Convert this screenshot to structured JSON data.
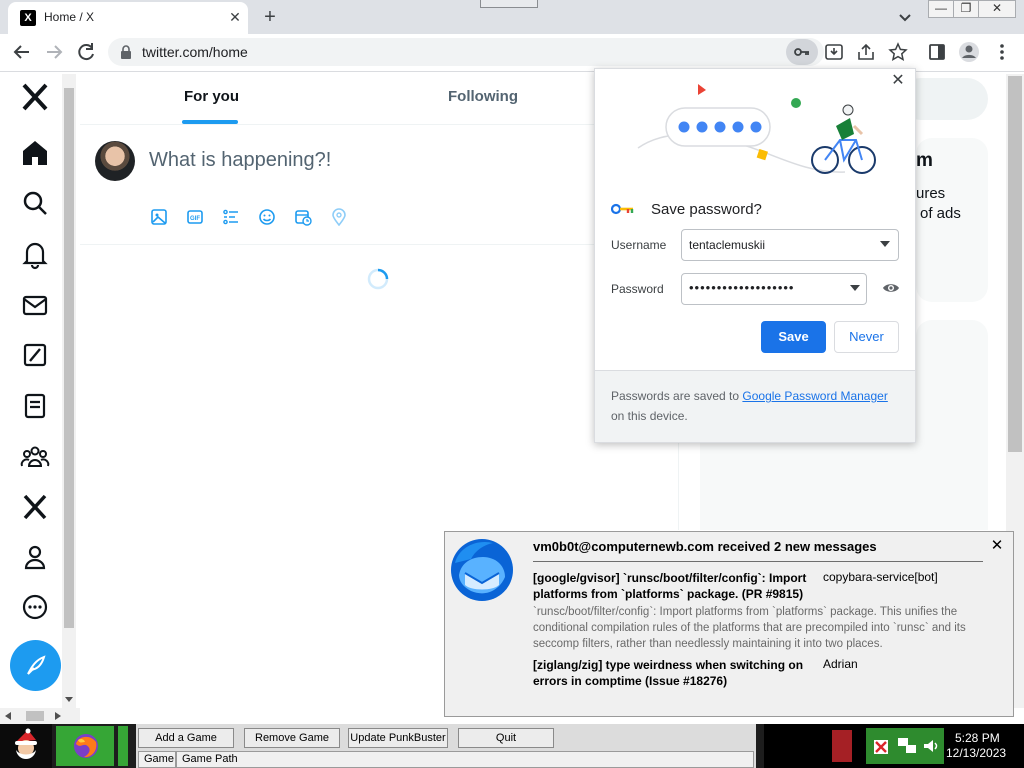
{
  "browser": {
    "tab_title": "Home / X",
    "tab_favicon": "X",
    "tab_close": "✕",
    "new_tab": "+",
    "url": "twitter.com/home",
    "window_buttons": [
      "—",
      "❐",
      "✕"
    ]
  },
  "twitter": {
    "tabs": [
      {
        "label": "For you",
        "active": true
      },
      {
        "label": "Following",
        "active": false
      }
    ],
    "compose_placeholder": "What is happening?!",
    "nav_icons": [
      "x-logo-icon",
      "home-icon",
      "search-icon",
      "bell-icon",
      "mail-icon",
      "slash-icon",
      "list-icon",
      "communities-icon",
      "x-premium-icon",
      "profile-icon",
      "more-icon",
      "compose-icon"
    ],
    "compose_icons": [
      "image-icon",
      "gif-icon",
      "poll-icon",
      "emoji-icon",
      "schedule-icon",
      "location-icon"
    ],
    "accent": "#1d9bf0",
    "right_fragments": [
      "m",
      "ures",
      "of ads"
    ]
  },
  "password_popup": {
    "title": "Save password?",
    "close": "✕",
    "username_label": "Username",
    "username_value": "tentaclemuskii",
    "password_label": "Password",
    "password_value": "•••••••••••••••••••",
    "save_label": "Save",
    "never_label": "Never",
    "footer_before": "Passwords are saved to ",
    "footer_link": "Google Password Manager",
    "footer_after": " on this device.",
    "accent": "#1a73e8"
  },
  "notification": {
    "title": "vm0b0t@computernewb.com received 2 new messages",
    "close": "✕",
    "messages": [
      {
        "subject": "[google/gvisor] `runsc/boot/filter/config`: Import platforms from `platforms` package. (PR #9815)",
        "from": "copybara-service[bot]",
        "body": "`runsc/boot/filter/config`: Import platforms from `platforms` package. This unifies the conditional compilation rules of the platforms that are precompiled into `runsc` and its seccomp filters, rather than needlessly maintaining it into two places."
      },
      {
        "subject": "[ziglang/zig] type weirdness when switching on errors in comptime (Issue #18276)",
        "from": "Adrian"
      }
    ]
  },
  "taskbar": {
    "buttons": [
      "Add a Game",
      "Remove Game",
      "Update PunkBuster",
      "Quit"
    ],
    "columns": [
      "Game",
      "Game Path"
    ],
    "clock_time": "5:28 PM",
    "clock_date": "12/13/2023"
  }
}
